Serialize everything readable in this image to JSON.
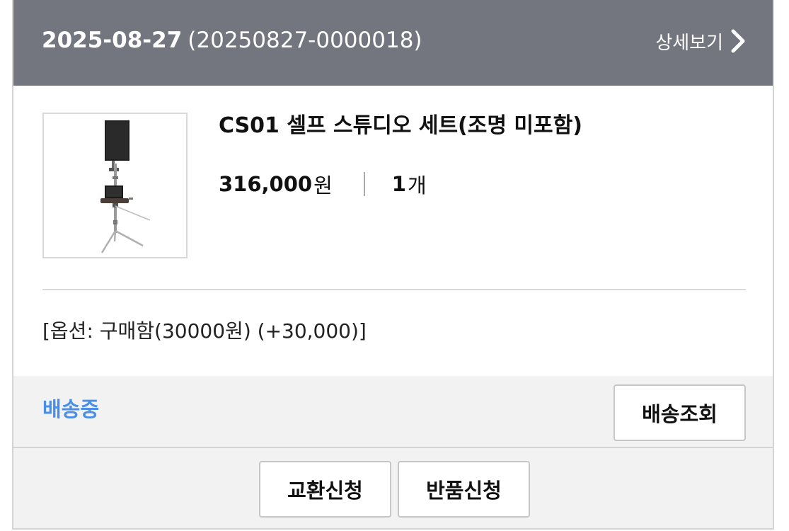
{
  "order": {
    "date": "2025-08-27",
    "order_number": "(20250827-0000018)",
    "detail_label": "상세보기"
  },
  "product": {
    "name": "CS01 셀프 스튜디오 세트(조명 미포함)",
    "price": "316,000",
    "price_unit": "원",
    "quantity": "1",
    "quantity_unit": "개",
    "option": "[옵션: 구매함(30000원) (+30,000)]"
  },
  "shipping": {
    "status": "배송중",
    "track_button": "배송조회"
  },
  "actions": {
    "exchange_button": "교환신청",
    "return_button": "반품신청"
  },
  "colors": {
    "header_bg": "#73767f",
    "status_blue": "#4a8ee6",
    "bar_bg": "#f2f2f2"
  },
  "icons": {
    "detail": "chevron-right-icon"
  }
}
